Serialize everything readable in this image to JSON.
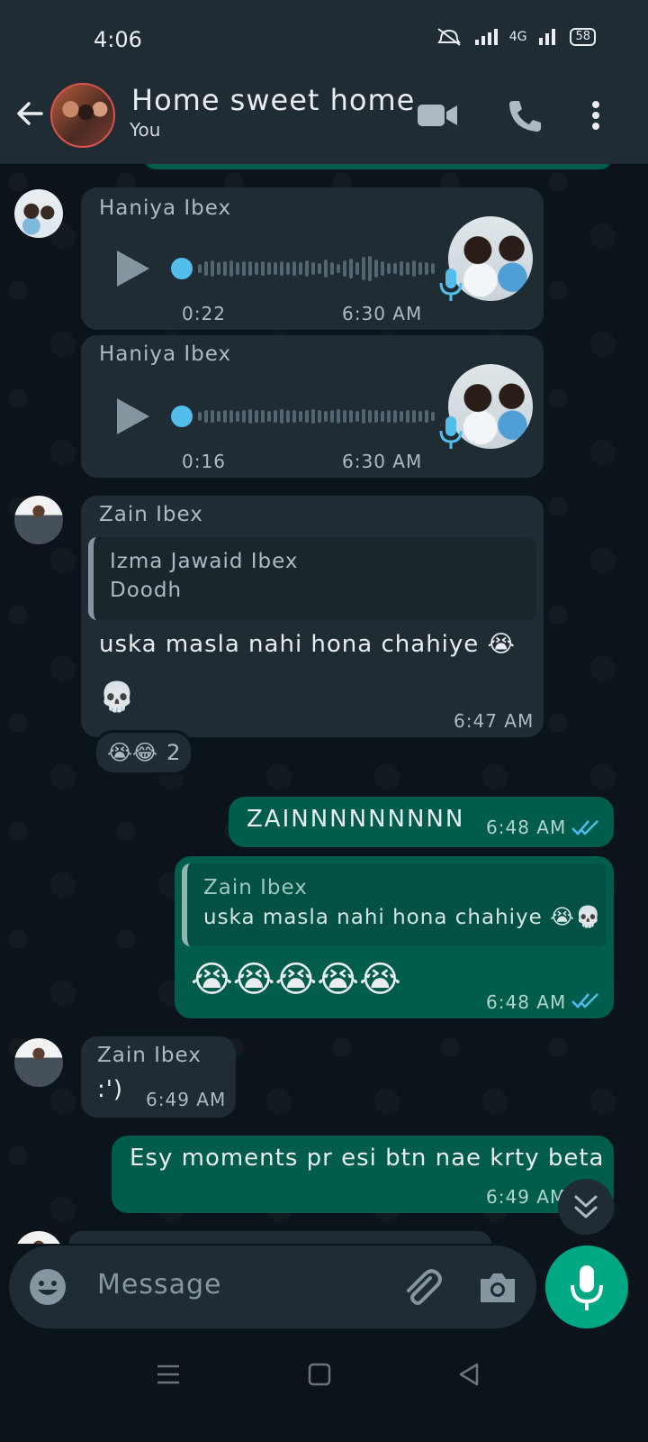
{
  "status_bar": {
    "time": "4:06",
    "network": "4G",
    "battery": "58"
  },
  "header": {
    "title": "Home sweet home",
    "subtitle": "You"
  },
  "messages": [
    {
      "type": "voice",
      "sender": "Haniya Ibex",
      "duration": "0:22",
      "time": "6:30 AM"
    },
    {
      "type": "voice",
      "sender": "Haniya Ibex",
      "duration": "0:16",
      "time": "6:30 AM"
    },
    {
      "type": "reply",
      "sender": "Zain Ibex",
      "quoted_sender": "Izma Jawaid Ibex",
      "quoted_text": "Doodh",
      "text": "uska masla nahi hona chahiye 😭",
      "text2": "💀",
      "time": "6:47 AM",
      "reactions": "😭😂",
      "reaction_count": "2"
    },
    {
      "type": "outgoing",
      "text": "ZAINNNNNNNNN",
      "time": "6:48 AM"
    },
    {
      "type": "outgoing-reply",
      "quoted_sender": "Zain Ibex",
      "quoted_text": "uska masla nahi hona chahiye 😭💀",
      "text": "😭😭😭😭😭",
      "time": "6:48 AM"
    },
    {
      "type": "incoming",
      "sender": "Zain Ibex",
      "text": ":')",
      "time": "6:49 AM"
    },
    {
      "type": "outgoing",
      "text": "Esy moments pr esi btn nae krty beta",
      "time": "6:49 AM"
    }
  ],
  "input": {
    "placeholder": "Message"
  },
  "colors": {
    "incoming_bubble": "#1f2c34",
    "outgoing_bubble": "#005c4b",
    "accent": "#00a884",
    "read_ticks": "#53bdeb"
  }
}
